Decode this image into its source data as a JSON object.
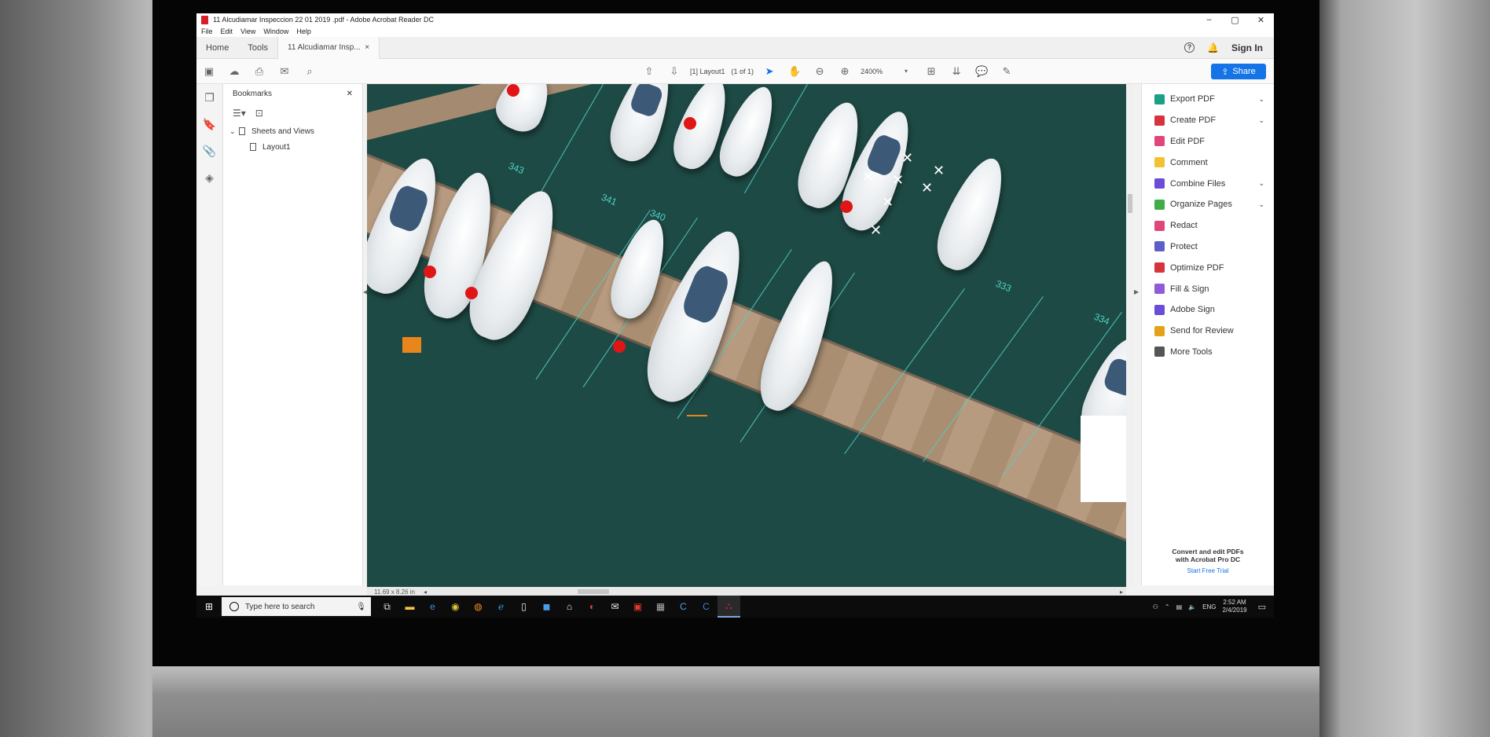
{
  "window": {
    "title": "11 Alcudiamar Inspeccion 22 01 2019 .pdf - Adobe Acrobat Reader DC",
    "controls": [
      "–",
      "▢",
      "✕"
    ]
  },
  "menu": [
    "File",
    "Edit",
    "View",
    "Window",
    "Help"
  ],
  "tabs": {
    "home": "Home",
    "tools": "Tools",
    "document": "11 Alcudiamar Insp...",
    "close": "×",
    "help": "?",
    "signin": "Sign In"
  },
  "toolbar": {
    "page_label": "[1] Layout1",
    "page_count": "(1 of 1)",
    "zoom": "2400%",
    "share": "Share"
  },
  "bookmarks": {
    "title": "Bookmarks",
    "close": "✕",
    "items": [
      {
        "label": "Sheets and Views",
        "expander": "⌄"
      },
      {
        "label": "Layout1"
      }
    ]
  },
  "document": {
    "page_size": "11.69 x 8.26 in",
    "slip_numbers": [
      "341",
      "340",
      "334",
      "343",
      "333"
    ]
  },
  "tools_pane": {
    "items": [
      {
        "label": "Export PDF",
        "color": "#1aa085",
        "expandable": true
      },
      {
        "label": "Create PDF",
        "color": "#d6333d",
        "expandable": true
      },
      {
        "label": "Edit PDF",
        "color": "#e0467c",
        "expandable": false
      },
      {
        "label": "Comment",
        "color": "#f1c232",
        "expandable": false
      },
      {
        "label": "Combine Files",
        "color": "#6a4ed8",
        "expandable": true
      },
      {
        "label": "Organize Pages",
        "color": "#3fae49",
        "expandable": true
      },
      {
        "label": "Redact",
        "color": "#e0467c",
        "expandable": false
      },
      {
        "label": "Protect",
        "color": "#5b5fc7",
        "expandable": false
      },
      {
        "label": "Optimize PDF",
        "color": "#d6333d",
        "expandable": false
      },
      {
        "label": "Fill & Sign",
        "color": "#8f5bd8",
        "expandable": false
      },
      {
        "label": "Adobe Sign",
        "color": "#6a4ed8",
        "expandable": false
      },
      {
        "label": "Send for Review",
        "color": "#e3a21a",
        "expandable": false
      },
      {
        "label": "More Tools",
        "color": "#555555",
        "expandable": false
      }
    ],
    "promo_line1": "Convert and edit PDFs",
    "promo_line2": "with Acrobat Pro DC",
    "promo_link": "Start Free Trial"
  },
  "taskbar": {
    "search_placeholder": "Type here to search",
    "language": "ENG",
    "time": "2:52 AM",
    "date": "2/4/2019"
  }
}
